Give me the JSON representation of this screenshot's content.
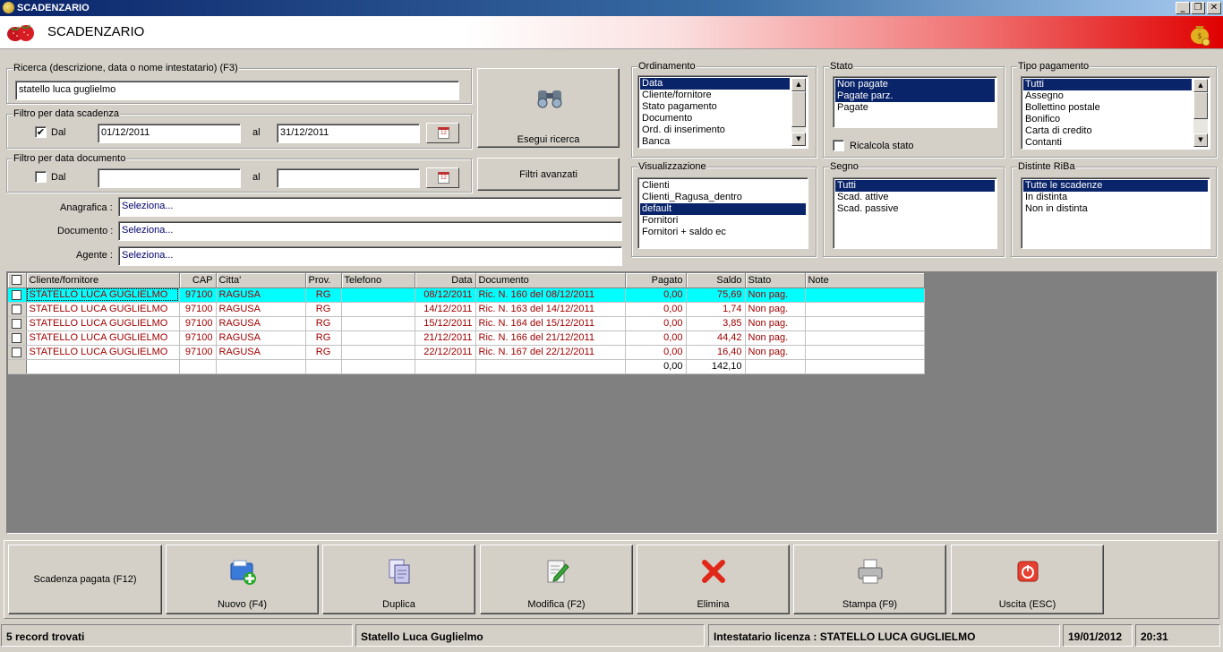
{
  "window": {
    "title": "SCADENZARIO",
    "min": "_",
    "restore": "❐",
    "close": "✕"
  },
  "header": {
    "title": "SCADENZARIO"
  },
  "search": {
    "legend": "Ricerca (descrizione, data o nome intestatario) (F3)",
    "value": "statello luca guglielmo"
  },
  "filtro_scadenza": {
    "legend": "Filtro per data scadenza",
    "checked": "✔",
    "dal_label": "Dal",
    "from": "01/12/2011",
    "al_label": "al",
    "to": "31/12/2011"
  },
  "filtro_documento": {
    "legend": "Filtro per data documento",
    "dal_label": "Dal",
    "from": "",
    "al_label": "al",
    "to": ""
  },
  "buttons": {
    "esegui": "Esegui ricerca",
    "filtri": "Filtri avanzati"
  },
  "anagrafica": {
    "label": "Anagrafica :",
    "value": "Seleziona..."
  },
  "documento": {
    "label": "Documento :",
    "value": "Seleziona..."
  },
  "agente": {
    "label": "Agente :",
    "value": "Seleziona..."
  },
  "ordinamento": {
    "legend": "Ordinamento",
    "items": [
      "Data",
      "Cliente/fornitore",
      "Stato pagamento",
      "Documento",
      "Ord. di inserimento",
      "Banca"
    ]
  },
  "stato": {
    "legend": "Stato",
    "items": [
      "Non pagate",
      "Pagate parz.",
      "Pagate"
    ],
    "ricalcola": "Ricalcola stato"
  },
  "tipo_pagamento": {
    "legend": "Tipo pagamento",
    "items": [
      "Tutti",
      "Assegno",
      "Bollettino postale",
      "Bonifico",
      "Carta di credito",
      "Contanti"
    ]
  },
  "visualizzazione": {
    "legend": "Visualizzazione",
    "items": [
      "Clienti",
      "Clienti_Ragusa_dentro",
      "default",
      "Fornitori",
      "Fornitori + saldo ec"
    ]
  },
  "segno": {
    "legend": "Segno",
    "items": [
      "Tutti",
      "Scad. attive",
      "Scad. passive"
    ]
  },
  "distinte": {
    "legend": "Distinte RiBa",
    "items": [
      "Tutte le scadenze",
      "In distinta",
      "Non in distinta"
    ]
  },
  "grid": {
    "columns": [
      "Cliente/fornitore",
      "CAP",
      "Citta'",
      "Prov.",
      "Telefono",
      "Data",
      "Documento",
      "Pagato",
      "Saldo",
      "Stato",
      "Note"
    ],
    "rows": [
      [
        "STATELLO LUCA GUGLIELMO",
        "97100",
        "RAGUSA",
        "RG",
        "",
        "08/12/2011",
        "Ric. N. 160 del 08/12/2011",
        "0,00",
        "75,69",
        "Non pag.",
        ""
      ],
      [
        "STATELLO LUCA GUGLIELMO",
        "97100",
        "RAGUSA",
        "RG",
        "",
        "14/12/2011",
        "Ric. N. 163 del 14/12/2011",
        "0,00",
        "1,74",
        "Non pag.",
        ""
      ],
      [
        "STATELLO LUCA GUGLIELMO",
        "97100",
        "RAGUSA",
        "RG",
        "",
        "15/12/2011",
        "Ric. N. 164 del 15/12/2011",
        "0,00",
        "3,85",
        "Non pag.",
        ""
      ],
      [
        "STATELLO LUCA GUGLIELMO",
        "97100",
        "RAGUSA",
        "RG",
        "",
        "21/12/2011",
        "Ric. N. 166 del 21/12/2011",
        "0,00",
        "44,42",
        "Non pag.",
        ""
      ],
      [
        "STATELLO LUCA GUGLIELMO",
        "97100",
        "RAGUSA",
        "RG",
        "",
        "22/12/2011",
        "Ric. N. 167 del 22/12/2011",
        "0,00",
        "16,40",
        "Non pag.",
        ""
      ]
    ],
    "totals": {
      "pagato": "0,00",
      "saldo": "142,10"
    }
  },
  "actions": {
    "pagata": "Scadenza pagata (F12)",
    "nuovo": "Nuovo (F4)",
    "duplica": "Duplica",
    "modifica": "Modifica (F2)",
    "elimina": "Elimina",
    "stampa": "Stampa (F9)",
    "uscita": "Uscita (ESC)"
  },
  "statusbar": {
    "records": "5 record trovati",
    "cliente": "Statello Luca Guglielmo",
    "licenza": "Intestatario licenza : STATELLO LUCA GUGLIELMO",
    "date": "19/01/2012",
    "time": "20:31"
  }
}
